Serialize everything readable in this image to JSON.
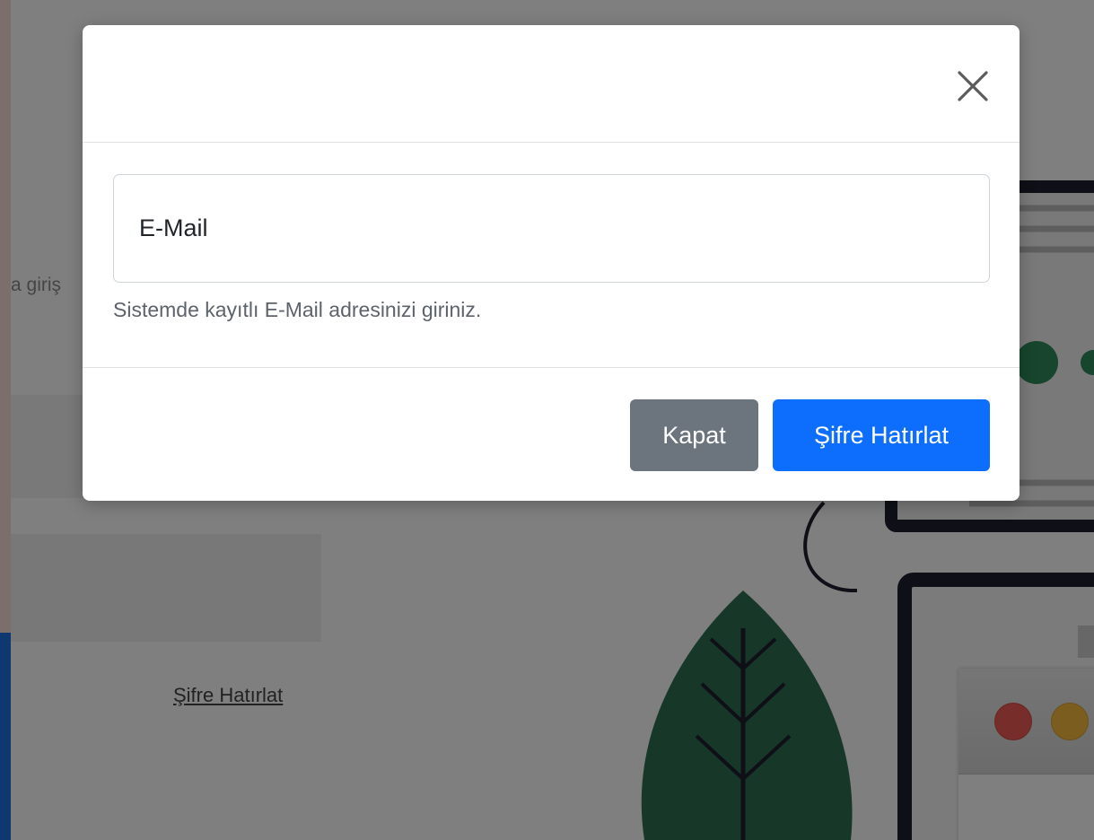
{
  "background": {
    "side_text": "a giriş",
    "link": "Şifre Hatırlat"
  },
  "modal": {
    "close_icon": "close-icon",
    "email_placeholder": "E-Mail",
    "email_value": "",
    "help_text": "Sistemde kayıtlı E-Mail adresinizi giriniz.",
    "buttons": {
      "close_label": "Kapat",
      "submit_label": "Şifre Hatırlat"
    }
  },
  "colors": {
    "primary": "#0d6efd",
    "secondary": "#6c757d",
    "leaf": "#2e6e52",
    "illustration_dark": "#1f1f2e",
    "accent_green": "#2f8a5a"
  }
}
